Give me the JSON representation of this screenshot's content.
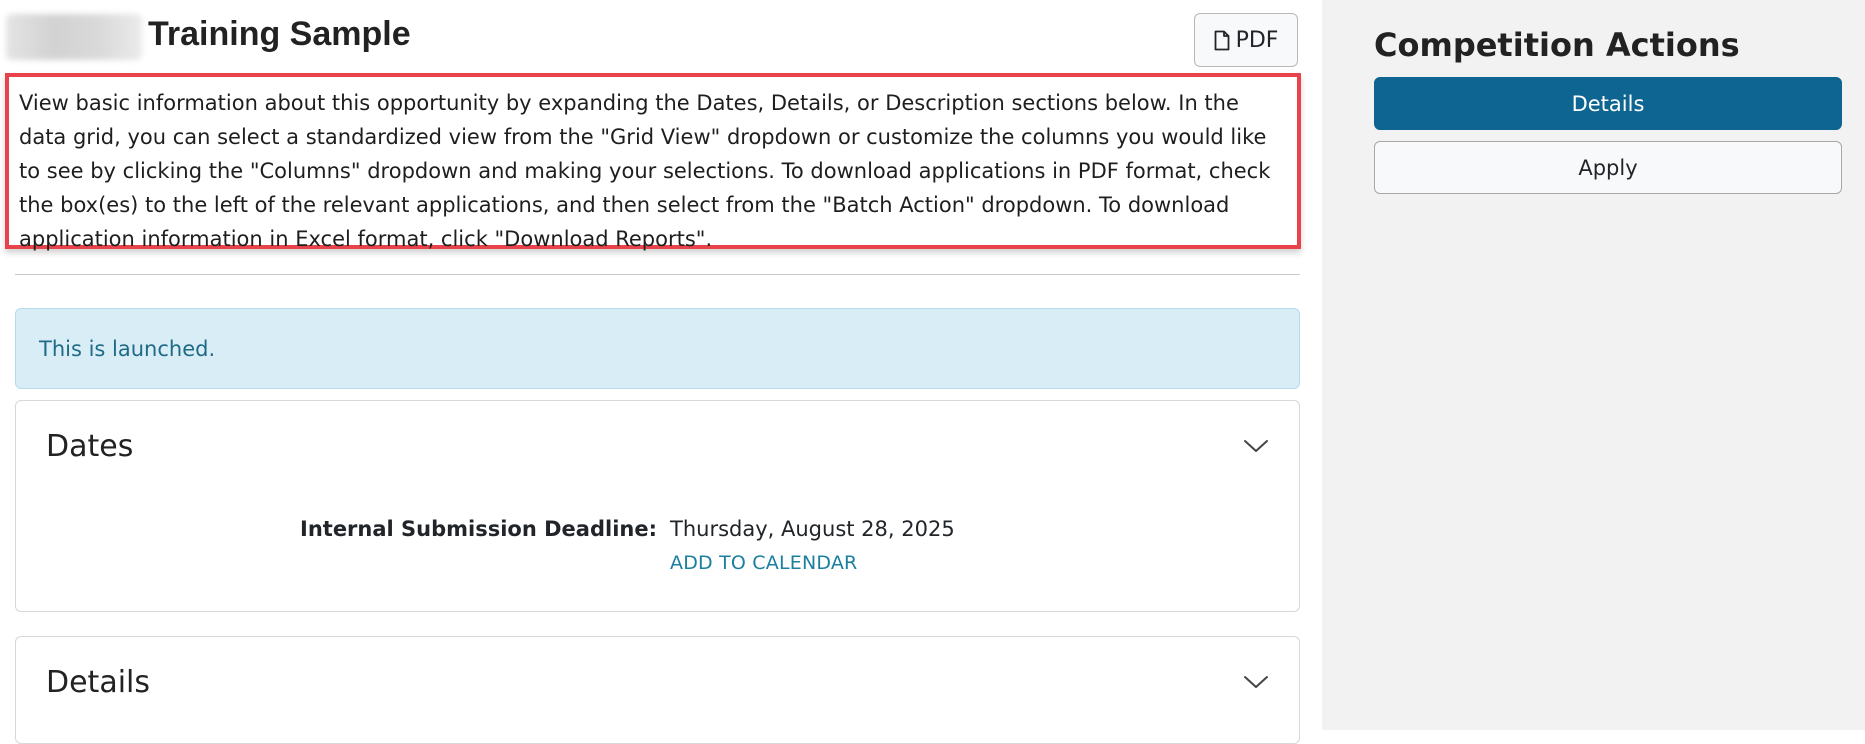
{
  "header": {
    "title": "Training Sample",
    "pdf_button_label": "PDF"
  },
  "instructions": "View basic information about this opportunity by expanding the Dates, Details, or Description sections below. In the data grid, you can select a standardized view from the \"Grid View\" dropdown or customize the columns you would like to see by clicking the \"Columns\" dropdown and making your selections. To download applications in PDF format, check the box(es) to the left of the relevant applications, and then select from the \"Batch Action\" dropdown. To download application information in Excel format, click \"Download Reports\".",
  "alert": {
    "text": "This is launched."
  },
  "dates_section": {
    "title": "Dates",
    "deadline_label": "Internal Submission Deadline:",
    "deadline_value": "Thursday, August 28, 2025",
    "add_to_calendar": "ADD TO CALENDAR"
  },
  "details_section": {
    "title": "Details"
  },
  "sidebar": {
    "title": "Competition Actions",
    "buttons": [
      {
        "label": "Details",
        "style": "primary"
      },
      {
        "label": "Apply",
        "style": "secondary"
      }
    ]
  },
  "colors": {
    "primary": "#0e6591",
    "highlight_border": "#e8434b",
    "alert_bg": "#d9edf6",
    "alert_text": "#1f6a87",
    "link": "#1b7fa0",
    "sidebar_bg": "#f2f2f3"
  },
  "icons": {
    "pdf": "file-icon",
    "section_toggle": "chevron-down-icon"
  }
}
